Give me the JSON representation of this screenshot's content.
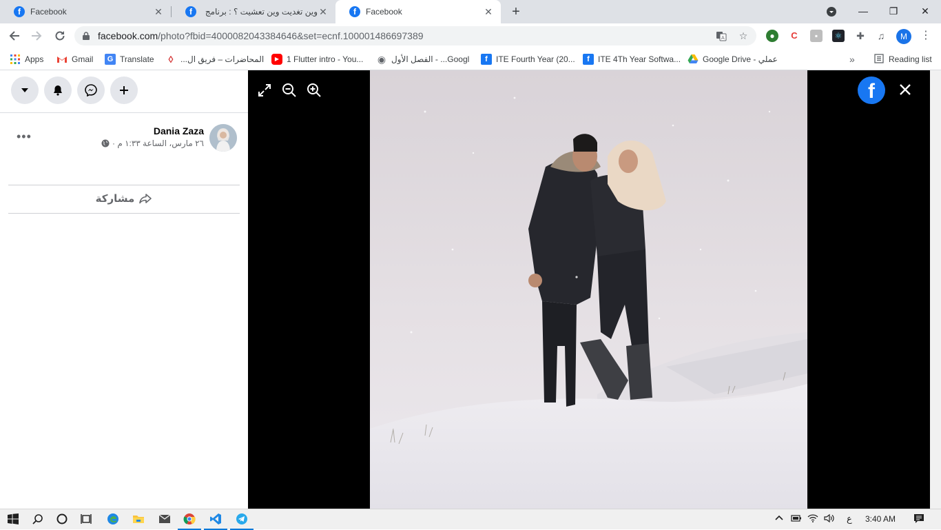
{
  "browser": {
    "tabs": [
      {
        "title": "Facebook",
        "active": false
      },
      {
        "title": "وين تغديت وين تعشيت ؟ : برنامج",
        "active": false
      },
      {
        "title": "Facebook",
        "active": true
      }
    ],
    "new_tab_label": "+",
    "url_host": "facebook.com",
    "url_path": "/photo?fbid=4000082043384646&set=ecnf.100001486697389",
    "profile_initial": "M",
    "bookmarks": [
      {
        "label": "Apps",
        "icon": "apps-grid-icon"
      },
      {
        "label": "Gmail",
        "icon": "gmail-icon"
      },
      {
        "label": "Translate",
        "icon": "translate-icon"
      },
      {
        "label": "المحاضرات – فريق ال...",
        "icon": "drop-icon"
      },
      {
        "label": "1 Flutter intro - You...",
        "icon": "youtube-icon"
      },
      {
        "label": "الفصل الأول - ...Googl",
        "icon": "globe-icon"
      },
      {
        "label": "ITE Fourth Year (20...",
        "icon": "facebook-icon"
      },
      {
        "label": "ITE 4Th Year Softwa...",
        "icon": "facebook-icon"
      },
      {
        "label": "Google Drive - عملي",
        "icon": "google-drive-icon"
      }
    ],
    "bookmarks_overflow": "»",
    "reading_list": "Reading list"
  },
  "post": {
    "author": "Dania Zaza",
    "timestamp": "٢٦ مارس، الساعة ١:٣٣ م ·",
    "share_label": "مشاركة",
    "more_label": "•••"
  },
  "viewer": {
    "logo_letter": "f"
  },
  "taskbar": {
    "lang": "ع",
    "time": "3:40 AM"
  },
  "colors": {
    "facebook_blue": "#1877f2",
    "viewer_bg": "#000000",
    "tabstrip_bg": "#dee1e6"
  }
}
